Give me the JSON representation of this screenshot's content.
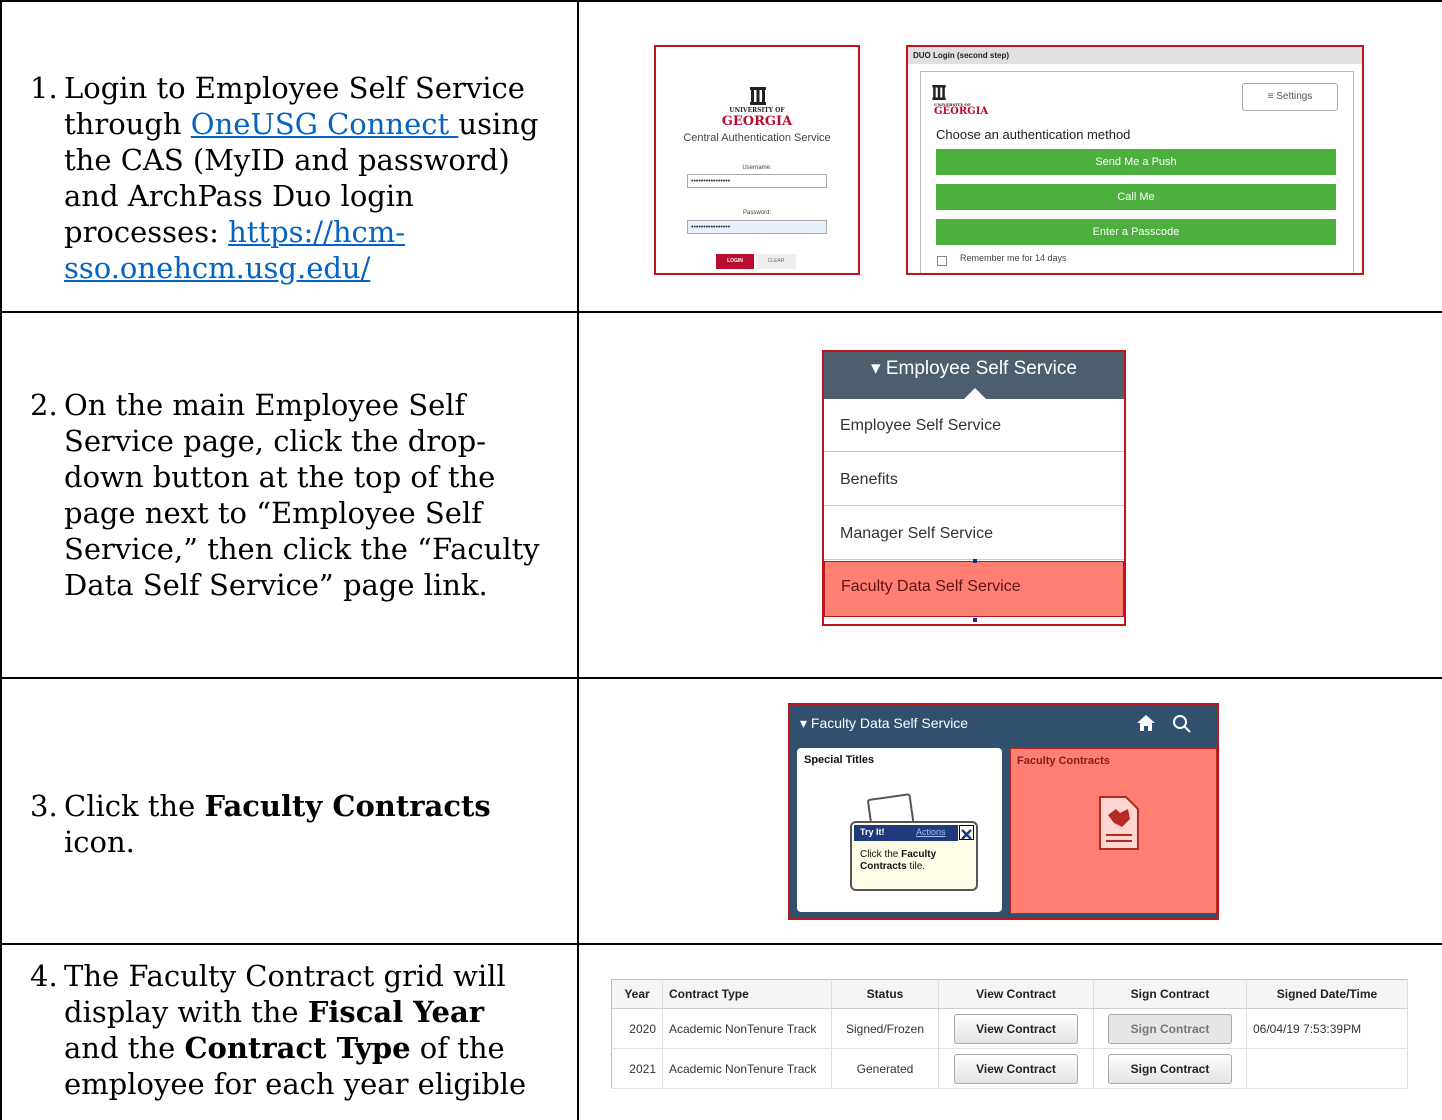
{
  "steps": [
    {
      "num": "1.",
      "text_a": "Login to Employee Self Service through ",
      "link_text": "OneUSG Connect ",
      "text_b": "using the CAS (MyID and password) and ArchPass Duo login processes: ",
      "url": "https://hcm-sso.onehcm.usg.edu/"
    },
    {
      "num": "2.",
      "text": "On the main Employee Self Service page, click the drop-down button at the top of the page next to “Employee Self Service,” then click the “Faculty Data Self Service” page link."
    },
    {
      "num": "3.",
      "text_a": "Click the ",
      "bold": "Faculty Contracts",
      "text_b": " icon."
    },
    {
      "num": "4.",
      "text_a": "The Faculty Contract grid will display with the ",
      "bold1": "Fiscal Year",
      "text_b": " and the ",
      "bold2": "Contract Type",
      "text_c": " of the employee for each year eligible"
    }
  ],
  "cas": {
    "univ_line1": "UNIVERSITY OF",
    "univ_line2": "GEORGIA",
    "service": "Central Authentication Service",
    "username_label": "Username:",
    "password_label": "Password:",
    "masked": "••••••••••••••••",
    "login": "LOGIN",
    "clear": "CLEAR"
  },
  "duo": {
    "header": "DUO Login (second step)",
    "settings": "≡  Settings",
    "prompt": "Choose an authentication method",
    "options": [
      "Send Me a Push",
      "Call Me",
      "Enter a Passcode"
    ],
    "remember": "Remember me for 14 days"
  },
  "ess_menu": {
    "header": "▾ Employee Self Service",
    "items": [
      "Employee Self Service",
      "Benefits",
      "Manager Self Service",
      "Faculty Data Self Service"
    ]
  },
  "fds": {
    "header": "▾ Faculty Data Self Service",
    "tile1": "Special Titles",
    "tile2": "Faculty Contracts",
    "tip_try": "Try It!",
    "tip_actions": "Actions",
    "tip_text_a": "Click the ",
    "tip_bold": "Faculty Contracts",
    "tip_text_b": " tile."
  },
  "contract_grid": {
    "headers": [
      "Year",
      "Contract Type",
      "Status",
      "View Contract",
      "Sign Contract",
      "Signed Date/Time"
    ],
    "rows": [
      {
        "year": "2020",
        "type": "Academic NonTenure Track",
        "status": "Signed/Frozen",
        "view": "View Contract",
        "sign": "Sign Contract",
        "signed": "06/04/19  7:53:39PM"
      },
      {
        "year": "2021",
        "type": "Academic NonTenure Track",
        "status": "Generated",
        "view": "View Contract",
        "sign": "Sign Contract",
        "signed": ""
      }
    ]
  },
  "colors": {
    "ugaRed": "#ba0c2f",
    "duoGreen": "#4caf3e",
    "highlight": "#ff7f73",
    "pplNavy": "#31506d",
    "link": "#0563c1"
  }
}
